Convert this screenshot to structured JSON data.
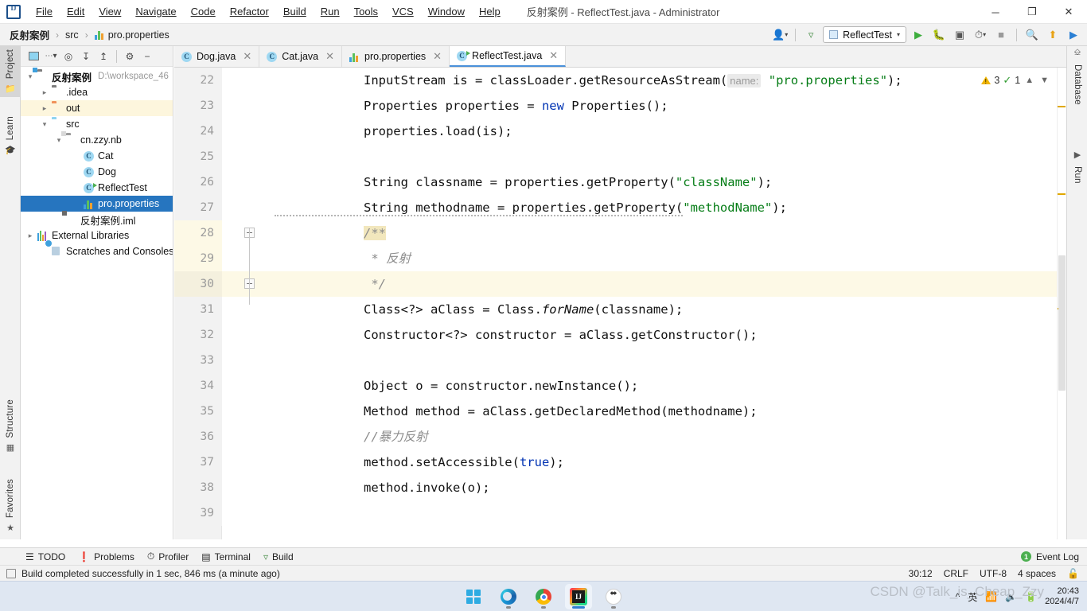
{
  "titlebar": {
    "app_icon": "intellij-logo",
    "menus": [
      "File",
      "Edit",
      "View",
      "Navigate",
      "Code",
      "Refactor",
      "Build",
      "Run",
      "Tools",
      "VCS",
      "Window",
      "Help"
    ],
    "window_title": "反射案例 - ReflectTest.java - Administrator",
    "minimize": "─",
    "maximize": "❐",
    "close": "✕"
  },
  "navbar": {
    "crumbs": [
      "反射案例",
      "src",
      "pro.properties"
    ],
    "separator": "›",
    "run_config": "ReflectTest",
    "icons": [
      "user-dropdown-icon",
      "hammer-build-icon",
      "run-icon",
      "debug-icon",
      "run-with-coverage-icon",
      "profiler-icon",
      "stop-icon",
      "search-everywhere-icon",
      "update-project-icon",
      "run-anything-icon"
    ]
  },
  "left_strip": {
    "tabs": [
      {
        "label": "Project",
        "icon": "project-folder-icon",
        "active": true
      },
      {
        "label": "Learn",
        "icon": "graduation-cap-icon",
        "active": false
      },
      {
        "label": "Structure",
        "icon": "structure-grid-icon",
        "active": false
      },
      {
        "label": "Favorites",
        "icon": "star-icon",
        "active": false
      }
    ]
  },
  "right_strip": {
    "tabs": [
      {
        "label": "Database",
        "icon": "database-icon"
      },
      {
        "label": "Run",
        "icon": "play-triangle-icon"
      }
    ]
  },
  "project_panel": {
    "toolbar_icons": [
      "project-view-selector",
      "locate-target-icon",
      "expand-all-icon",
      "collapse-all-icon",
      "settings-gear-icon",
      "hide-panel-icon"
    ],
    "tree": [
      {
        "label": "反射案例",
        "detail": "D:\\workspace_46",
        "icon": "project-root-folder-icon",
        "depth": 0,
        "arrow": "expanded",
        "bold": true,
        "state": "normal"
      },
      {
        "label": ".idea",
        "detail": "",
        "icon": "folder-gray-icon",
        "depth": 1,
        "arrow": "collapsed",
        "bold": false,
        "state": "normal"
      },
      {
        "label": "out",
        "detail": "",
        "icon": "folder-orange-icon",
        "depth": 1,
        "arrow": "collapsed",
        "bold": false,
        "state": "highlight"
      },
      {
        "label": "src",
        "detail": "",
        "icon": "folder-blue-source-icon",
        "depth": 1,
        "arrow": "expanded",
        "bold": false,
        "state": "normal"
      },
      {
        "label": "cn.zzy.nb",
        "detail": "",
        "icon": "package-icon",
        "depth": 2,
        "arrow": "expanded",
        "bold": false,
        "state": "normal"
      },
      {
        "label": "Cat",
        "detail": "",
        "icon": "java-class-icon",
        "depth": 3,
        "arrow": "none",
        "bold": false,
        "state": "normal"
      },
      {
        "label": "Dog",
        "detail": "",
        "icon": "java-class-icon",
        "depth": 3,
        "arrow": "none",
        "bold": false,
        "state": "normal"
      },
      {
        "label": "ReflectTest",
        "detail": "",
        "icon": "java-runnable-class-icon",
        "depth": 3,
        "arrow": "none",
        "bold": false,
        "state": "normal"
      },
      {
        "label": "pro.properties",
        "detail": "",
        "icon": "properties-file-icon",
        "depth": 3,
        "arrow": "none",
        "bold": false,
        "state": "selected"
      },
      {
        "label": "反射案例.iml",
        "detail": "",
        "icon": "iml-module-file-icon",
        "depth": 2,
        "arrow": "none",
        "bold": false,
        "state": "normal"
      },
      {
        "label": "External Libraries",
        "detail": "",
        "icon": "external-libraries-icon",
        "depth": 0,
        "arrow": "collapsed",
        "bold": false,
        "state": "normal"
      },
      {
        "label": "Scratches and Consoles",
        "detail": "",
        "icon": "scratches-icon",
        "depth": 0,
        "arrow": "none",
        "bold": false,
        "state": "normal"
      }
    ]
  },
  "editor": {
    "tabs": [
      {
        "label": "Dog.java",
        "icon": "java-class-icon",
        "active": false
      },
      {
        "label": "Cat.java",
        "icon": "java-class-icon",
        "active": false
      },
      {
        "label": "pro.properties",
        "icon": "properties-file-icon",
        "active": false
      },
      {
        "label": "ReflectTest.java",
        "icon": "java-runnable-class-icon",
        "active": true
      }
    ],
    "close_glyph": "✕",
    "inspection": {
      "warning_count": "3",
      "ok_count": "1",
      "warning_icon": "warning-triangle-icon",
      "ok_icon": "inspection-check-icon",
      "prev_icon": "chevron-up-icon",
      "next_icon": "chevron-down-icon"
    },
    "lines": [
      {
        "num": "22",
        "tokens": [
          {
            "t": "            InputStream is = classLoader.getResourceAsStream(",
            "c": "plain"
          },
          {
            "t": "name:",
            "c": "hint"
          },
          {
            "t": " ",
            "c": "plain"
          },
          {
            "t": "\"pro.properties\"",
            "c": "str"
          },
          {
            "t": ");",
            "c": "plain"
          }
        ]
      },
      {
        "num": "23",
        "tokens": [
          {
            "t": "            Properties properties = ",
            "c": "plain"
          },
          {
            "t": "new",
            "c": "kw"
          },
          {
            "t": " Properties();",
            "c": "plain"
          }
        ]
      },
      {
        "num": "24",
        "tokens": [
          {
            "t": "            properties.load(is);",
            "c": "plain"
          }
        ]
      },
      {
        "num": "25",
        "tokens": []
      },
      {
        "num": "26",
        "tokens": [
          {
            "t": "            String classname = properties.getProperty(",
            "c": "plain"
          },
          {
            "t": "\"className\"",
            "c": "str"
          },
          {
            "t": ");",
            "c": "plain"
          }
        ]
      },
      {
        "num": "27",
        "tokens": [
          {
            "t": "            String methodname = properties.getProperty(",
            "c": "plain"
          },
          {
            "t": "\"methodName\"",
            "c": "str"
          },
          {
            "t": ");",
            "c": "plain"
          }
        ]
      },
      {
        "num": "28",
        "tokens": [
          {
            "t": "            ",
            "c": "plain"
          },
          {
            "t": "/**",
            "c": "cmt-hl"
          }
        ]
      },
      {
        "num": "29",
        "tokens": [
          {
            "t": "             * 反射",
            "c": "cmt"
          }
        ]
      },
      {
        "num": "30",
        "tokens": [
          {
            "t": "             */",
            "c": "cmt"
          }
        ]
      },
      {
        "num": "31",
        "tokens": [
          {
            "t": "            Class<?> aClass = Class.",
            "c": "plain"
          },
          {
            "t": "forName",
            "c": "ital"
          },
          {
            "t": "(classname);",
            "c": "plain"
          }
        ]
      },
      {
        "num": "32",
        "tokens": [
          {
            "t": "            Constructor<?> constructor = aClass.getConstructor();",
            "c": "plain"
          }
        ]
      },
      {
        "num": "33",
        "tokens": []
      },
      {
        "num": "34",
        "tokens": [
          {
            "t": "            Object o = constructor.newInstance();",
            "c": "plain"
          }
        ]
      },
      {
        "num": "35",
        "tokens": [
          {
            "t": "            Method method = aClass.getDeclaredMethod(methodname);",
            "c": "plain"
          }
        ]
      },
      {
        "num": "36",
        "tokens": [
          {
            "t": "            //暴力反射",
            "c": "cmt"
          }
        ]
      },
      {
        "num": "37",
        "tokens": [
          {
            "t": "            method.setAccessible(",
            "c": "plain"
          },
          {
            "t": "true",
            "c": "kw"
          },
          {
            "t": ");",
            "c": "plain"
          }
        ]
      },
      {
        "num": "38",
        "tokens": [
          {
            "t": "            method.invoke(o);",
            "c": "plain"
          }
        ]
      },
      {
        "num": "39",
        "tokens": []
      }
    ],
    "current_line_num": "30",
    "folds": [
      "28",
      "30"
    ]
  },
  "bottom_bar": {
    "items": [
      {
        "label": "TODO",
        "icon": "todo-list-icon"
      },
      {
        "label": "Problems",
        "icon": "problems-warning-icon"
      },
      {
        "label": "Profiler",
        "icon": "profiler-icon"
      },
      {
        "label": "Terminal",
        "icon": "terminal-icon"
      },
      {
        "label": "Build",
        "icon": "build-hammer-icon"
      }
    ],
    "event_log": {
      "label": "Event Log",
      "count": "1",
      "icon": "event-log-badge-icon"
    }
  },
  "status_bar": {
    "message": "Build completed successfully in 1 sec, 846 ms (a minute ago)",
    "message_icon": "build-status-icon",
    "caret_position": "30:12",
    "line_separator": "CRLF",
    "encoding": "UTF-8",
    "indent": "4 spaces",
    "lock_icon": "unlocked-padlock-icon"
  },
  "taskbar": {
    "apps": [
      {
        "name": "start-windows-icon",
        "active": false,
        "running": false
      },
      {
        "name": "microsoft-edge-icon",
        "active": false,
        "running": true
      },
      {
        "name": "google-chrome-icon",
        "active": false,
        "running": true
      },
      {
        "name": "intellij-idea-icon",
        "active": true,
        "running": true
      },
      {
        "name": "network-tool-icon",
        "active": false,
        "running": true
      }
    ],
    "tray": [
      "chevron-up-tray-icon",
      "ime-chinese-icon",
      "wifi-icon",
      "volume-icon",
      "battery-icon"
    ],
    "tray_labels": {
      "ime": "英"
    },
    "clock": {
      "time": "20:43",
      "date": "2024/4/7"
    }
  },
  "watermark": "CSDN @Talk_is_Cheap_Zzy",
  "colors": {
    "accent": "#2675bf",
    "selection": "#2675bf",
    "warning": "#f0b400",
    "success": "#4caf50",
    "string": "#067d17",
    "keyword": "#0033b3",
    "current_line": "#fdf9e6"
  }
}
